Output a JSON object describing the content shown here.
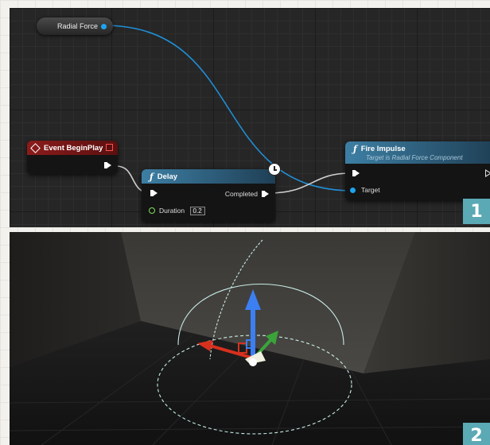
{
  "panel1": {
    "variable_node": {
      "label": "Radial Force"
    },
    "event_node": {
      "title": "Event BeginPlay"
    },
    "delay_node": {
      "title": "Delay",
      "completed_label": "Completed",
      "duration_label": "Duration",
      "duration_value": "0.2"
    },
    "impulse_node": {
      "title": "Fire Impulse",
      "subtitle": "Target is Radial Force Component",
      "target_label": "Target"
    },
    "badge": "1"
  },
  "panel2": {
    "badge": "2"
  },
  "colors": {
    "object_pin": "#1ea3ef",
    "event_header": "#8b1b1b",
    "function_header": "#3a6f8f",
    "badge": "#5aa9b5"
  }
}
